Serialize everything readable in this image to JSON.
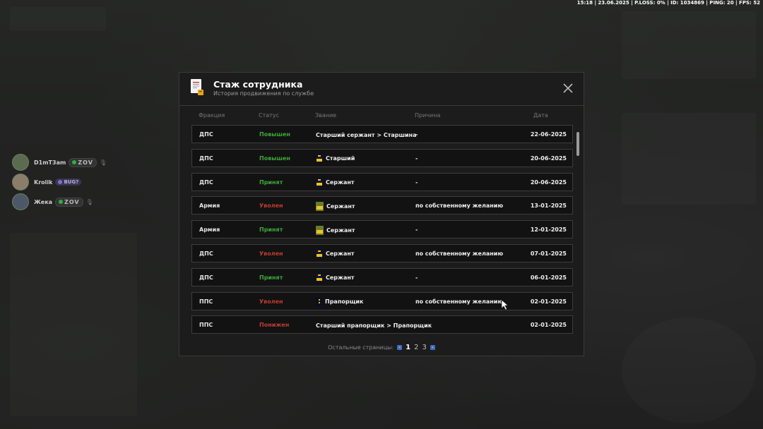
{
  "hud": {
    "status_line": "15:18 | 23.06.2025 | P.LOSS: 0% | ID: 1034869 | PING: 20 | FPS: 52"
  },
  "players": [
    {
      "name": "D1mT3am",
      "tag": "ZOV"
    },
    {
      "name": "Krolik",
      "tag": "BUG?"
    },
    {
      "name": "Жека",
      "tag": "ZOV"
    }
  ],
  "modal": {
    "title": "Стаж сотрудника",
    "subtitle": "История продвижения по службе",
    "columns": {
      "faction": "Фракция",
      "status": "Статус",
      "rank": "Звание",
      "reason": "Причина",
      "date": "Дата"
    },
    "rows": [
      {
        "faction": "ДПС",
        "status": "Повышен",
        "status_color": "green",
        "rank_icon": "none",
        "rank": "Старший сержант > Старшина",
        "reason": "-",
        "date": "22-06-2025"
      },
      {
        "faction": "ДПС",
        "status": "Повышен",
        "status_color": "green",
        "rank_icon": "dps-insignia",
        "rank": "Старший",
        "reason": "-",
        "date": "20-06-2025"
      },
      {
        "faction": "ДПС",
        "status": "Принят",
        "status_color": "green",
        "rank_icon": "dps-insignia",
        "rank": "Сержант",
        "reason": "-",
        "date": "20-06-2025"
      },
      {
        "faction": "Армия",
        "status": "Уволен",
        "status_color": "red",
        "rank_icon": "army-insignia",
        "rank": "Сержант",
        "reason": "по собственному желанию",
        "date": "13-01-2025"
      },
      {
        "faction": "Армия",
        "status": "Принят",
        "status_color": "green",
        "rank_icon": "army-insignia",
        "rank": "Сержант",
        "reason": "-",
        "date": "12-01-2025"
      },
      {
        "faction": "ДПС",
        "status": "Уволен",
        "status_color": "red",
        "rank_icon": "dps-insignia",
        "rank": "Сержант",
        "reason": "по собственному желанию",
        "date": "07-01-2025"
      },
      {
        "faction": "ДПС",
        "status": "Принят",
        "status_color": "green",
        "rank_icon": "dps-insignia",
        "rank": "Сержант",
        "reason": "-",
        "date": "06-01-2025"
      },
      {
        "faction": "ППС",
        "status": "Уволен",
        "status_color": "red",
        "rank_icon": "pps-insignia",
        "rank": "Прапорщик",
        "reason": "по собственному желанию",
        "date": "02-01-2025"
      },
      {
        "faction": "ППС",
        "status": "Понижен",
        "status_color": "red",
        "rank_icon": "none",
        "rank": "Старший прапорщик > Прапорщик",
        "reason": "",
        "date": "02-01-2025"
      }
    ],
    "pagination": {
      "label": "Остальные страницы:",
      "pages": [
        "1",
        "2",
        "3"
      ],
      "current": "1"
    }
  },
  "colors": {
    "status_green": "#3ea83a",
    "status_red": "#c23a34",
    "pagination_arrow": "#3d6fbf"
  }
}
